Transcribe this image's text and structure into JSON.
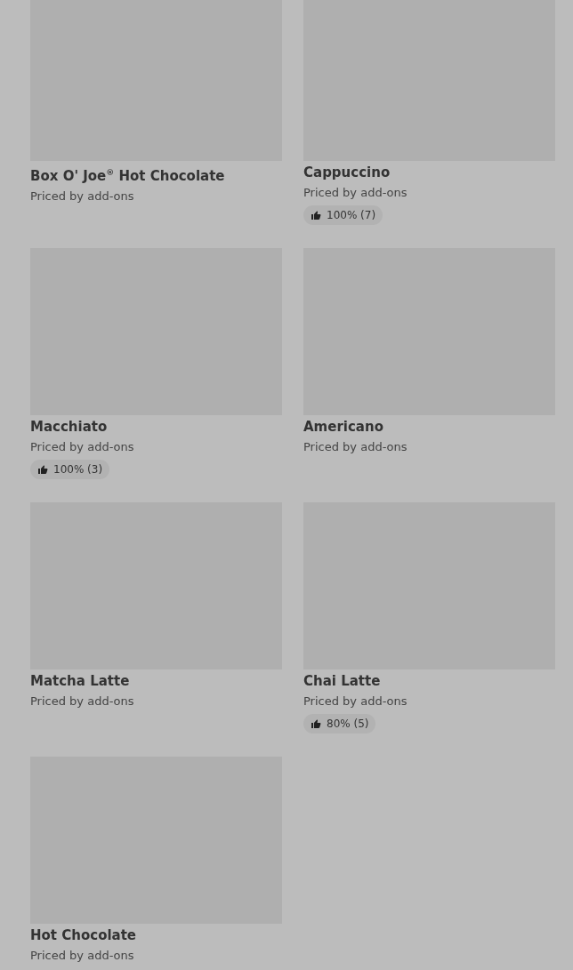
{
  "items": [
    {
      "name": "Box O' Joe$^{®}$ Hot Chocolate",
      "subtitle": "Priced by add-ons"
    },
    {
      "name": "Cappuccino",
      "subtitle": "Priced by add-ons",
      "rating": "100% (7)"
    },
    {
      "name": "Macchiato",
      "subtitle": "Priced by add-ons",
      "rating": "100% (3)"
    },
    {
      "name": "Americano",
      "subtitle": "Priced by add-ons"
    },
    {
      "name": "Matcha Latte",
      "subtitle": "Priced by add-ons"
    },
    {
      "name": "Chai Latte",
      "subtitle": "Priced by add-ons",
      "rating": "80% (5)"
    },
    {
      "name": "Hot Chocolate",
      "subtitle": "Priced by add-ons"
    }
  ]
}
